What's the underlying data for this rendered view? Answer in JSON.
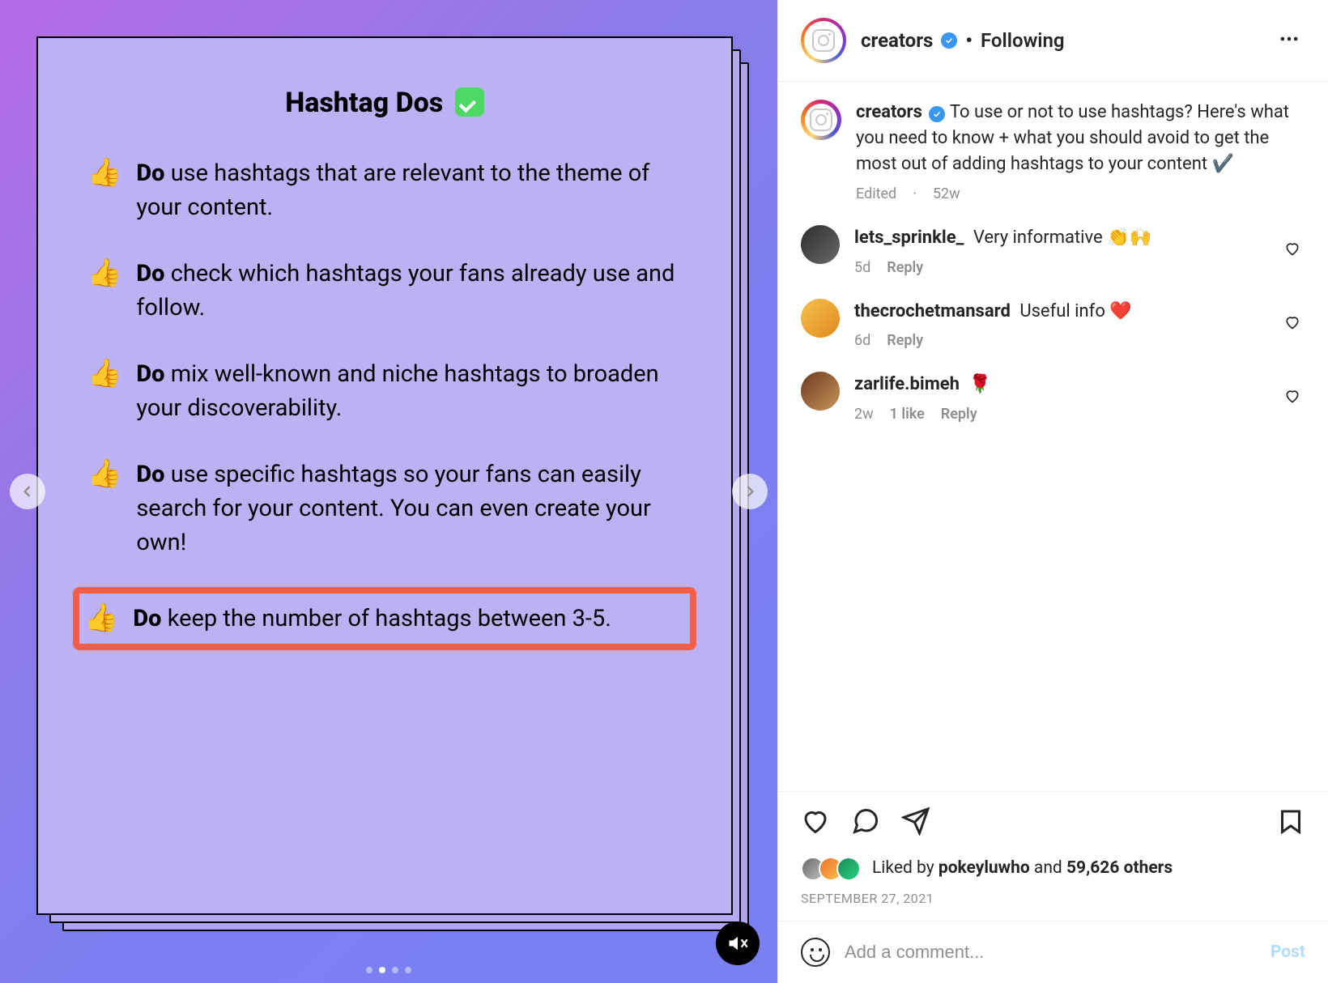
{
  "media": {
    "title": "Hashtag Dos",
    "title_emoji": "check",
    "items": [
      {
        "bold": "Do",
        "text": " use hashtags that are relevant to the theme of your content.",
        "highlighted": false
      },
      {
        "bold": "Do",
        "text": " check which hashtags your fans already use and follow.",
        "highlighted": false
      },
      {
        "bold": "Do",
        "text": " mix well-known and niche hashtags to broaden your discoverability.",
        "highlighted": false
      },
      {
        "bold": "Do",
        "text": " use specific hashtags so your fans can easily search for your content. You can even create your own!",
        "highlighted": false
      },
      {
        "bold": "Do",
        "text": " keep the number of hashtags between 3-5.",
        "highlighted": true
      }
    ],
    "dots_total": 4,
    "dots_active_index": 1
  },
  "header": {
    "username": "creators",
    "verified": true,
    "separator": "•",
    "follow_state": "Following"
  },
  "caption": {
    "username": "creators",
    "verified": true,
    "text": "To use or not to use hashtags? Here's what you need to know + what you should avoid to get the most out of adding hashtags to your content ✔️",
    "edited_label": "Edited",
    "age": "52w"
  },
  "comments": [
    {
      "username": "lets_sprinkle_",
      "text": "Very informative 👏🙌",
      "age": "5d",
      "likes": "",
      "reply": "Reply"
    },
    {
      "username": "thecrochetmansard",
      "text": "Useful info ❤️",
      "age": "6d",
      "likes": "",
      "reply": "Reply"
    },
    {
      "username": "zarlife.bimeh",
      "text": "🌹",
      "age": "2w",
      "likes": "1 like",
      "reply": "Reply"
    }
  ],
  "likes": {
    "prefix": "Liked by ",
    "lead_user": "pokeyluwho",
    "middle": " and ",
    "others_count": "59,626 others"
  },
  "post_date": "SEPTEMBER 27, 2021",
  "add_comment": {
    "placeholder": "Add a comment...",
    "post_label": "Post"
  }
}
